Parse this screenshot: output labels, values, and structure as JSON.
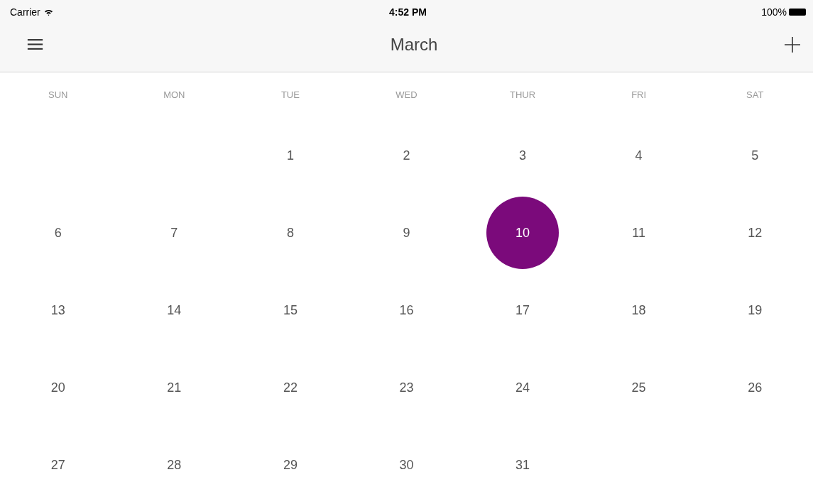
{
  "status_bar": {
    "carrier": "Carrier",
    "time": "4:52 PM",
    "battery": "100%"
  },
  "nav_bar": {
    "title": "March"
  },
  "weekdays": [
    "SUN",
    "MON",
    "TUE",
    "WED",
    "THUR",
    "FRI",
    "SAT"
  ],
  "weeks": [
    [
      {
        "kind": "blank"
      },
      {
        "kind": "blank"
      },
      {
        "kind": "day",
        "label": "1",
        "selected": false
      },
      {
        "kind": "day",
        "label": "2",
        "selected": false
      },
      {
        "kind": "day",
        "label": "3",
        "selected": false
      },
      {
        "kind": "day",
        "label": "4",
        "selected": false
      },
      {
        "kind": "day",
        "label": "5",
        "selected": false
      }
    ],
    [
      {
        "kind": "day",
        "label": "6",
        "selected": false
      },
      {
        "kind": "day",
        "label": "7",
        "selected": false
      },
      {
        "kind": "day",
        "label": "8",
        "selected": false
      },
      {
        "kind": "day",
        "label": "9",
        "selected": false
      },
      {
        "kind": "day",
        "label": "10",
        "selected": true
      },
      {
        "kind": "day",
        "label": "11",
        "selected": false
      },
      {
        "kind": "day",
        "label": "12",
        "selected": false
      }
    ],
    [
      {
        "kind": "day",
        "label": "13",
        "selected": false
      },
      {
        "kind": "day",
        "label": "14",
        "selected": false
      },
      {
        "kind": "day",
        "label": "15",
        "selected": false
      },
      {
        "kind": "day",
        "label": "16",
        "selected": false
      },
      {
        "kind": "day",
        "label": "17",
        "selected": false
      },
      {
        "kind": "day",
        "label": "18",
        "selected": false
      },
      {
        "kind": "day",
        "label": "19",
        "selected": false
      }
    ],
    [
      {
        "kind": "day",
        "label": "20",
        "selected": false
      },
      {
        "kind": "day",
        "label": "21",
        "selected": false
      },
      {
        "kind": "day",
        "label": "22",
        "selected": false
      },
      {
        "kind": "day",
        "label": "23",
        "selected": false
      },
      {
        "kind": "day",
        "label": "24",
        "selected": false
      },
      {
        "kind": "day",
        "label": "25",
        "selected": false
      },
      {
        "kind": "day",
        "label": "26",
        "selected": false
      }
    ],
    [
      {
        "kind": "day",
        "label": "27",
        "selected": false
      },
      {
        "kind": "day",
        "label": "28",
        "selected": false
      },
      {
        "kind": "day",
        "label": "29",
        "selected": false
      },
      {
        "kind": "day",
        "label": "30",
        "selected": false
      },
      {
        "kind": "day",
        "label": "31",
        "selected": false
      },
      {
        "kind": "blank"
      },
      {
        "kind": "blank"
      }
    ]
  ]
}
